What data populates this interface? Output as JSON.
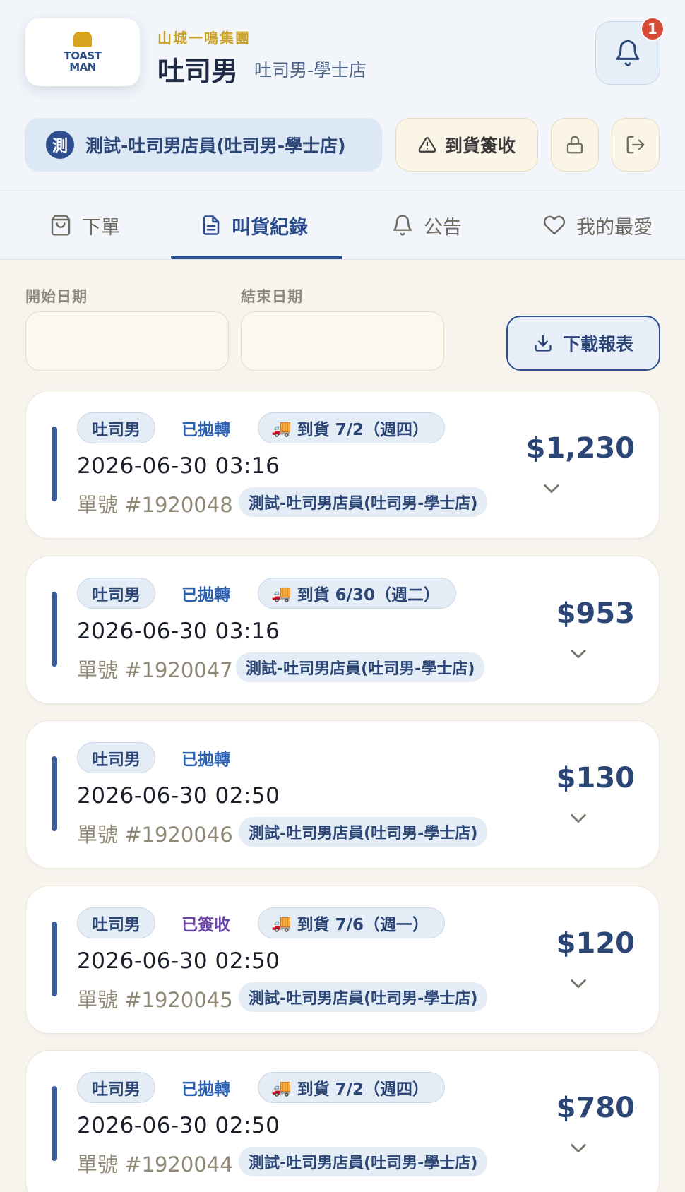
{
  "header": {
    "logo_text_line1": "TOAST",
    "logo_text_line2": "MAN",
    "group_name": "山城一鳴集團",
    "brand_name": "吐司男",
    "store_name": "吐司男-學士店",
    "notification_count": "1"
  },
  "user": {
    "avatar_char": "測",
    "name": "測試-吐司男店員(吐司男-學士店)"
  },
  "actions": {
    "receive_label": "到貨簽收"
  },
  "tabs": [
    {
      "label": "下單",
      "icon": "shopping-bag-icon"
    },
    {
      "label": "叫貨紀錄",
      "icon": "document-icon"
    },
    {
      "label": "公告",
      "icon": "bell-icon"
    },
    {
      "label": "我的最愛",
      "icon": "heart-icon"
    }
  ],
  "filters": {
    "start_label": "開始日期",
    "end_label": "結束日期",
    "start_value": "",
    "end_value": "",
    "download_label": "下載報表"
  },
  "colors": {
    "primary": "#2d4f8f",
    "accent_gold": "#c9a227",
    "status_transferred": "#2b5fb0",
    "status_received": "#6b45a8",
    "badge": "#d64b37"
  },
  "orders": [
    {
      "brand": "吐司男",
      "status": "已拋轉",
      "status_type": "transferred",
      "delivery": "到貨 7/2（週四）",
      "time": "2026-06-30 03:16",
      "order_no": "單號 #1920048",
      "staff": "測試-吐司男店員(吐司男-學士店)",
      "amount": "$1,230"
    },
    {
      "brand": "吐司男",
      "status": "已拋轉",
      "status_type": "transferred",
      "delivery": "到貨 6/30（週二）",
      "time": "2026-06-30 03:16",
      "order_no": "單號 #1920047",
      "staff": "測試-吐司男店員(吐司男-學士店)",
      "amount": "$953"
    },
    {
      "brand": "吐司男",
      "status": "已拋轉",
      "status_type": "transferred",
      "delivery": "",
      "time": "2026-06-30 02:50",
      "order_no": "單號 #1920046",
      "staff": "測試-吐司男店員(吐司男-學士店)",
      "amount": "$130"
    },
    {
      "brand": "吐司男",
      "status": "已簽收",
      "status_type": "received",
      "delivery": "到貨 7/6（週一）",
      "time": "2026-06-30 02:50",
      "order_no": "單號 #1920045",
      "staff": "測試-吐司男店員(吐司男-學士店)",
      "amount": "$120"
    },
    {
      "brand": "吐司男",
      "status": "已拋轉",
      "status_type": "transferred",
      "delivery": "到貨 7/2（週四）",
      "time": "2026-06-30 02:50",
      "order_no": "單號 #1920044",
      "staff": "測試-吐司男店員(吐司男-學士店)",
      "amount": "$780"
    }
  ]
}
